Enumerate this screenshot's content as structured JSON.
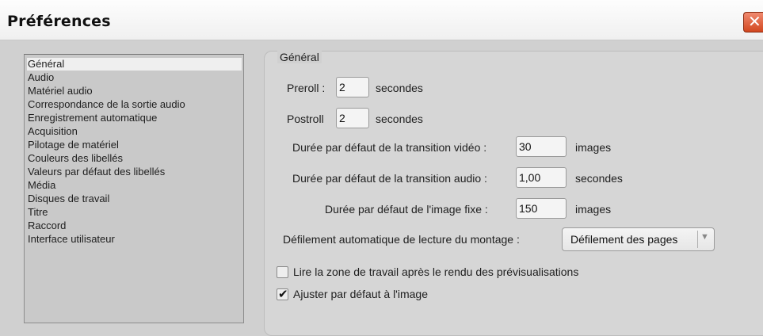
{
  "window": {
    "title": "Préférences"
  },
  "categories": [
    "Général",
    "Audio",
    "Matériel audio",
    "Correspondance de la sortie audio",
    "Enregistrement automatique",
    "Acquisition",
    "Pilotage de matériel",
    "Couleurs des libellés",
    "Valeurs par défaut des libellés",
    "Média",
    "Disques de travail",
    "Titre",
    "Raccord",
    "Interface utilisateur"
  ],
  "selected_category": "Général",
  "panel": {
    "group_title": "Général",
    "preroll": {
      "label": "Preroll :",
      "value": "2",
      "unit": "secondes"
    },
    "postroll": {
      "label": "Postroll",
      "value": "2",
      "unit": "secondes"
    },
    "video_transition": {
      "label": "Durée par défaut de la transition vidéo :",
      "value": "30",
      "unit": "images"
    },
    "audio_transition": {
      "label": "Durée par défaut de la transition audio :",
      "value": "1,00",
      "unit": "secondes"
    },
    "still_image": {
      "label": "Durée par défaut de l'image fixe :",
      "value": "150",
      "unit": "images"
    },
    "autoscroll": {
      "label": "Défilement automatique de lecture du montage :",
      "value": "Défilement des pages"
    },
    "play_work_area": {
      "label": "Lire la zone de travail après le rendu des prévisualisations",
      "checked": false
    },
    "fit_to_frame": {
      "label": "Ajuster par défaut à l'image",
      "checked": true
    }
  },
  "colors": {
    "close_button": "#d2471f",
    "background": "#d0d0d0",
    "list_selection": "#efefef"
  }
}
